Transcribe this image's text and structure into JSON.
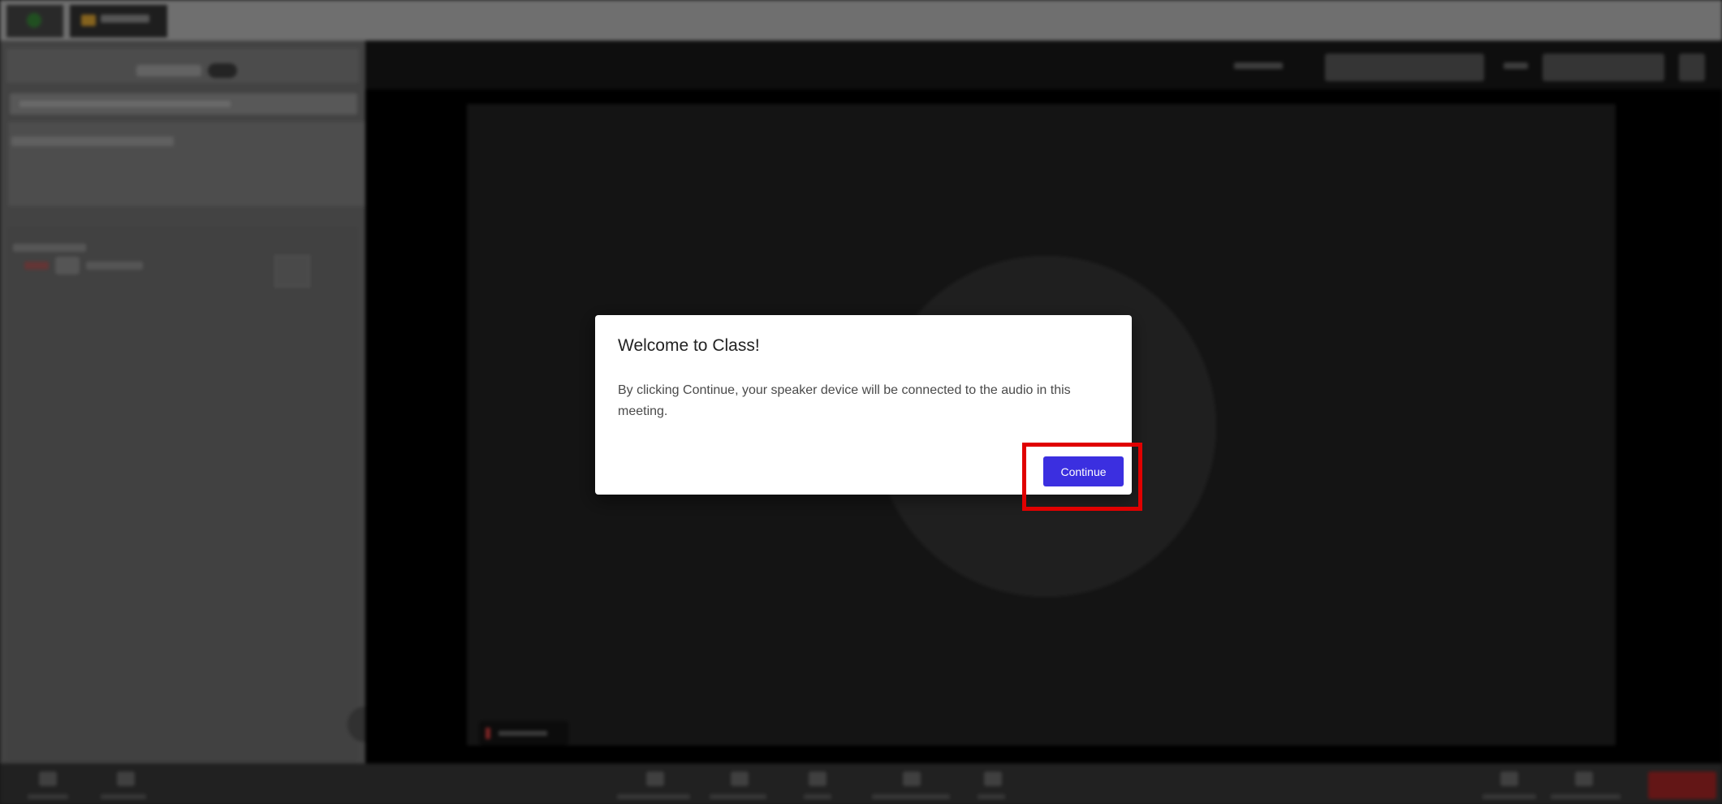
{
  "dialog": {
    "title": "Welcome to Class!",
    "message": "By clicking Continue, your speaker device will be connected to the audio in this meeting.",
    "continue_label": "Continue"
  },
  "colors": {
    "primary_button": "#3b2fe0",
    "highlight_box": "#e00000",
    "dialog_background": "#ffffff"
  },
  "icons": {
    "app_tab_a": "shield-icon",
    "app_tab_b": "class-app-icon",
    "collapse_sidebar": "chevron-left-icon",
    "end_button": "leave-icon"
  }
}
